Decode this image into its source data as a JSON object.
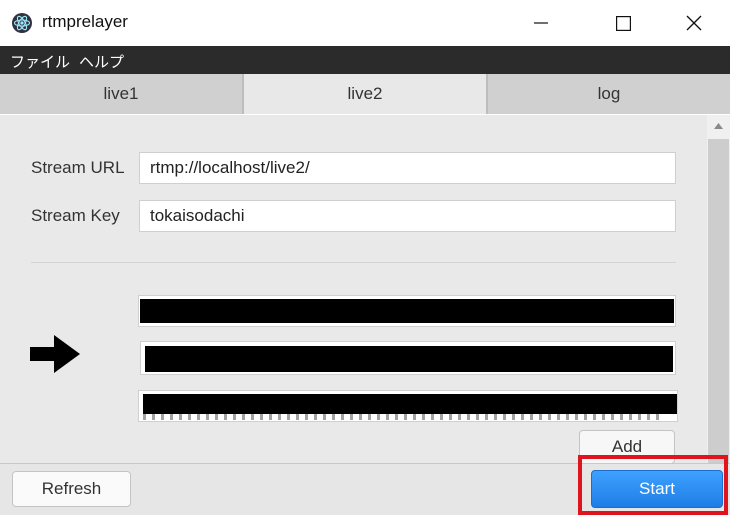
{
  "window": {
    "title": "rtmprelayer",
    "app_icon": "electron-atom-icon",
    "controls": [
      "minimize-icon",
      "maximize-icon",
      "close-icon"
    ]
  },
  "menu": {
    "file": "ファイル",
    "help": "ヘルプ"
  },
  "tabs": [
    {
      "label": "live1",
      "active": false
    },
    {
      "label": "live2",
      "active": true
    },
    {
      "label": "log",
      "active": false
    }
  ],
  "form": {
    "stream_url_label": "Stream URL",
    "stream_url_value": "rtmp://localhost/live2/",
    "stream_key_label": "Stream Key",
    "stream_key_value": "tokaisodachi"
  },
  "destinations": {
    "arrow_icon": "arrow-right-icon",
    "fields": [
      "redacted",
      "redacted",
      "redacted"
    ],
    "add_label": "Add"
  },
  "footer": {
    "refresh_label": "Refresh",
    "start_label": "Start"
  },
  "colors": {
    "menubar": "#2b2b2b",
    "start_button": "#1f7ee6",
    "highlight": "#e0141e"
  }
}
